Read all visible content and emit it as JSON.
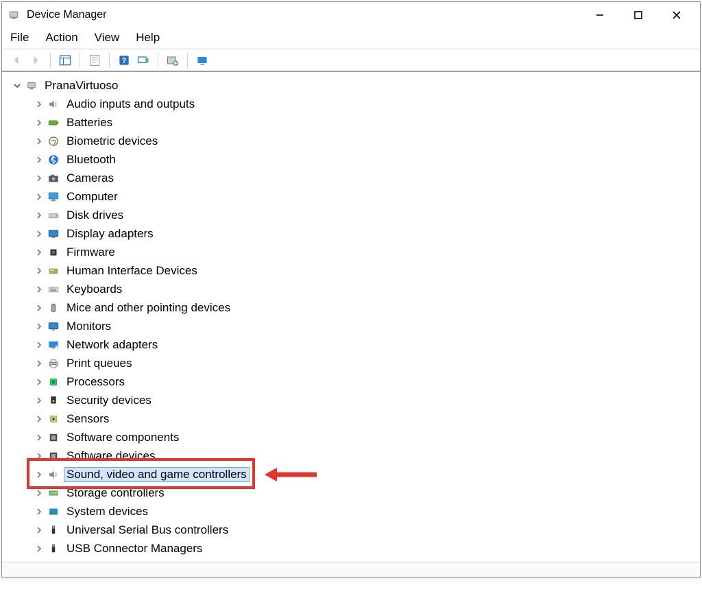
{
  "window": {
    "title": "Device Manager"
  },
  "menu": {
    "file": "File",
    "action": "Action",
    "view": "View",
    "help": "Help"
  },
  "tree": {
    "root": "PranaVirtuoso",
    "items": [
      {
        "label": "Audio inputs and outputs",
        "icon": "speaker"
      },
      {
        "label": "Batteries",
        "icon": "battery"
      },
      {
        "label": "Biometric devices",
        "icon": "fingerprint"
      },
      {
        "label": "Bluetooth",
        "icon": "bluetooth"
      },
      {
        "label": "Cameras",
        "icon": "camera"
      },
      {
        "label": "Computer",
        "icon": "computer"
      },
      {
        "label": "Disk drives",
        "icon": "disk"
      },
      {
        "label": "Display adapters",
        "icon": "display"
      },
      {
        "label": "Firmware",
        "icon": "chip"
      },
      {
        "label": "Human Interface Devices",
        "icon": "hid"
      },
      {
        "label": "Keyboards",
        "icon": "keyboard"
      },
      {
        "label": "Mice and other pointing devices",
        "icon": "mouse"
      },
      {
        "label": "Monitors",
        "icon": "monitor"
      },
      {
        "label": "Network adapters",
        "icon": "network"
      },
      {
        "label": "Print queues",
        "icon": "printer"
      },
      {
        "label": "Processors",
        "icon": "cpu"
      },
      {
        "label": "Security devices",
        "icon": "security"
      },
      {
        "label": "Sensors",
        "icon": "sensor"
      },
      {
        "label": "Software components",
        "icon": "software"
      },
      {
        "label": "Software devices",
        "icon": "software"
      },
      {
        "label": "Sound, video and game controllers",
        "icon": "speaker",
        "selected": true
      },
      {
        "label": "Storage controllers",
        "icon": "storage"
      },
      {
        "label": "System devices",
        "icon": "system"
      },
      {
        "label": "Universal Serial Bus controllers",
        "icon": "usb"
      },
      {
        "label": "USB Connector Managers",
        "icon": "usb"
      }
    ]
  }
}
